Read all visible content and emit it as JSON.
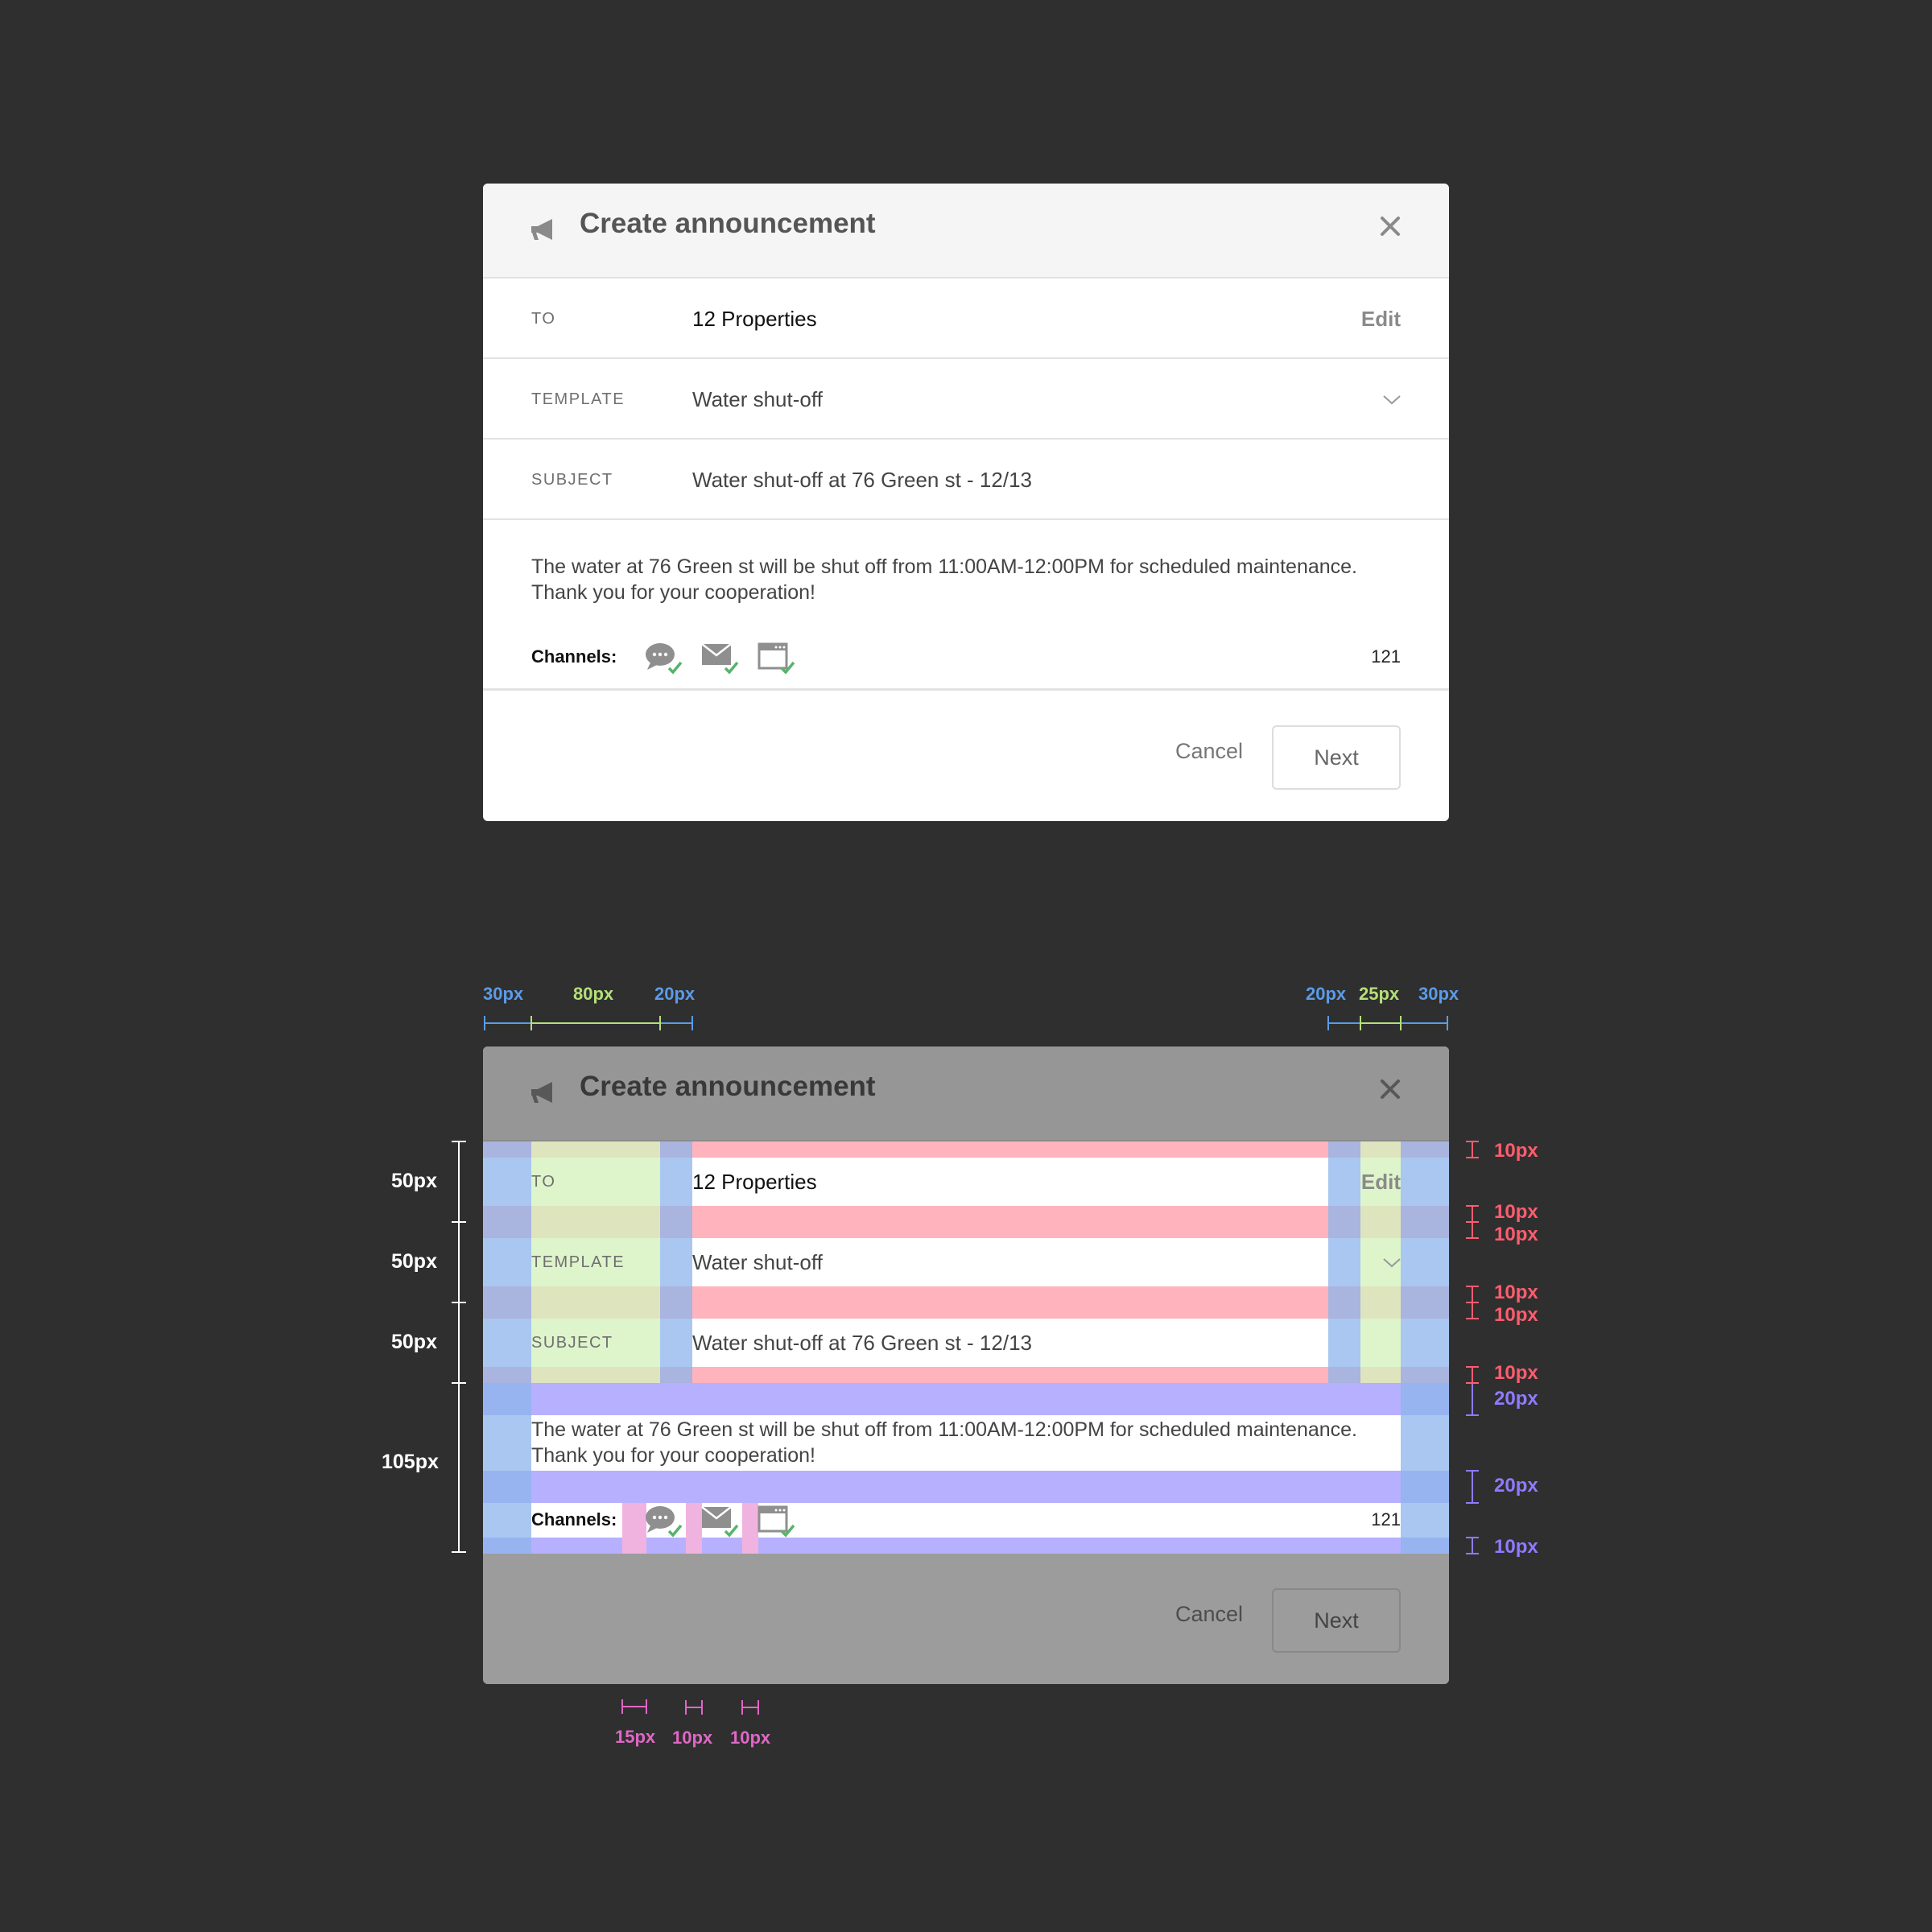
{
  "modal": {
    "title": "Create announcement",
    "to_label": "TO",
    "to_value": "12 Properties",
    "edit_label": "Edit",
    "template_label": "TEMPLATE",
    "template_value": "Water shut-off",
    "subject_label": "SUBJECT",
    "subject_value": "Water shut-off at 76 Green st - 12/13",
    "message_line1": "The water at 76 Green st will be shut off from 11:00AM-12:00PM for scheduled maintenance.",
    "message_line2": "Thank you for your cooperation!",
    "channels_label": "Channels:",
    "channel_icons": [
      "chat-bubble-icon",
      "envelope-icon",
      "browser-window-icon"
    ],
    "char_count": "121",
    "cancel_label": "Cancel",
    "next_label": "Next"
  },
  "annotations": {
    "top": [
      "30px",
      "80px",
      "20px",
      "20px",
      "25px",
      "30px"
    ],
    "left": [
      "50px",
      "50px",
      "50px",
      "105px"
    ],
    "right": [
      "10px",
      "10px",
      "10px",
      "10px",
      "10px",
      "10px",
      "20px",
      "20px",
      "10px"
    ],
    "bottom": [
      "15px",
      "10px",
      "10px"
    ]
  },
  "colors": {
    "background": "#2f2f2f",
    "padding_blue": "#aecbf0",
    "label_green": "#ddf3c8",
    "row_padding_red": "#ffb3bd",
    "body_padding_purple": "#b6b0ff",
    "icon_gap_pink": "#f0b3e0"
  }
}
